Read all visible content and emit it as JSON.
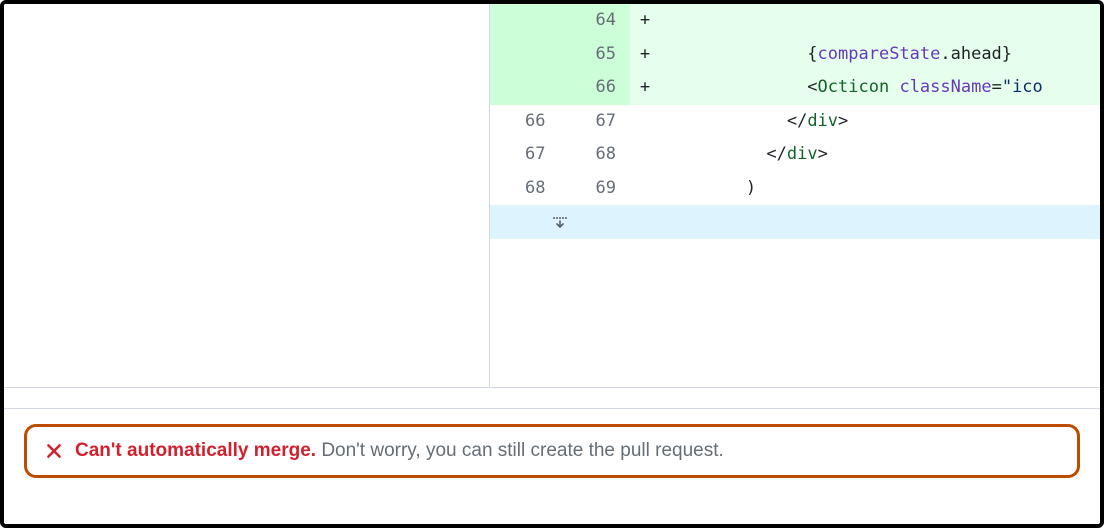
{
  "diff": {
    "rows": [
      {
        "type": "add",
        "old": "",
        "new": "64",
        "marker": "+",
        "indent": 8,
        "tokens": []
      },
      {
        "type": "add",
        "old": "",
        "new": "65",
        "marker": "+",
        "indent": 14,
        "tokens": [
          {
            "cls": "tok-plain",
            "t": "{"
          },
          {
            "cls": "tok-var",
            "t": "compareState"
          },
          {
            "cls": "tok-plain",
            "t": ".ahead}"
          }
        ]
      },
      {
        "type": "add",
        "old": "",
        "new": "66",
        "marker": "+",
        "indent": 14,
        "tokens": [
          {
            "cls": "tok-plain",
            "t": "<"
          },
          {
            "cls": "tok-ent",
            "t": "Octicon"
          },
          {
            "cls": "tok-plain",
            "t": " "
          },
          {
            "cls": "tok-attr",
            "t": "className"
          },
          {
            "cls": "tok-plain",
            "t": "="
          },
          {
            "cls": "tok-str",
            "t": "\"ico"
          }
        ]
      },
      {
        "type": "ctx",
        "old": "66",
        "new": "67",
        "marker": "",
        "indent": 12,
        "tokens": [
          {
            "cls": "tok-plain",
            "t": "</"
          },
          {
            "cls": "tok-ent",
            "t": "div"
          },
          {
            "cls": "tok-plain",
            "t": ">"
          }
        ]
      },
      {
        "type": "ctx",
        "old": "67",
        "new": "68",
        "marker": "",
        "indent": 10,
        "tokens": [
          {
            "cls": "tok-plain",
            "t": "</"
          },
          {
            "cls": "tok-ent",
            "t": "div"
          },
          {
            "cls": "tok-plain",
            "t": ">"
          }
        ]
      },
      {
        "type": "ctx",
        "old": "68",
        "new": "69",
        "marker": "",
        "indent": 8,
        "tokens": [
          {
            "cls": "tok-plain",
            "t": ")"
          }
        ]
      }
    ],
    "expand_down_title": "Expand Down"
  },
  "notice": {
    "strong": "Can't automatically merge.",
    "body": "Don't worry, you can still create the pull request."
  }
}
